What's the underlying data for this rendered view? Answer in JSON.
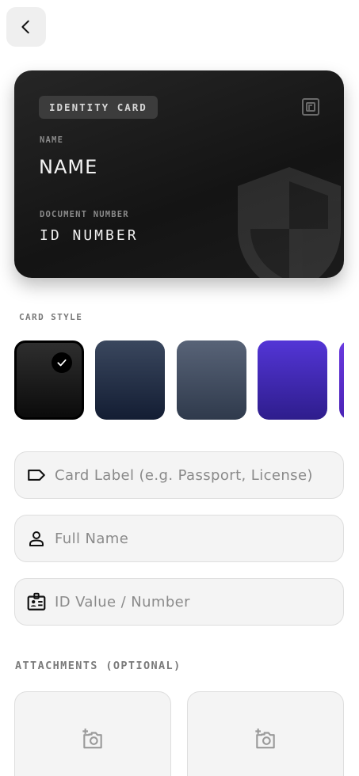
{
  "card": {
    "type_label": "IDENTITY CARD",
    "name_label": "NAME",
    "name_value": "NAME",
    "number_label": "DOCUMENT NUMBER",
    "number_value": "ID NUMBER"
  },
  "card_style": {
    "label": "CARD STYLE",
    "selected_index": 0,
    "swatches": [
      {
        "name": "black",
        "from": "#2e2e2e",
        "to": "#0b0b0b"
      },
      {
        "name": "navy",
        "from": "#3a475e",
        "to": "#131d33"
      },
      {
        "name": "slate",
        "from": "#586377",
        "to": "#2f3a4c"
      },
      {
        "name": "indigo",
        "from": "#5335d6",
        "to": "#2e1d8c"
      },
      {
        "name": "violet",
        "from": "#6a3ae0",
        "to": "#4a22b5"
      }
    ]
  },
  "fields": {
    "label_placeholder": "Card Label (e.g. Passport, License)",
    "name_placeholder": "Full Name",
    "id_placeholder": "ID Value / Number"
  },
  "attachments": {
    "label": "ATTACHMENTS (OPTIONAL)"
  },
  "icons": {
    "back": "chevron-left-icon",
    "nfc": "nfc-icon",
    "watermark": "shield-icon",
    "check": "check-icon",
    "label": "tag-icon",
    "person": "person-icon",
    "id": "id-badge-icon",
    "add_photo": "add-photo-icon"
  }
}
